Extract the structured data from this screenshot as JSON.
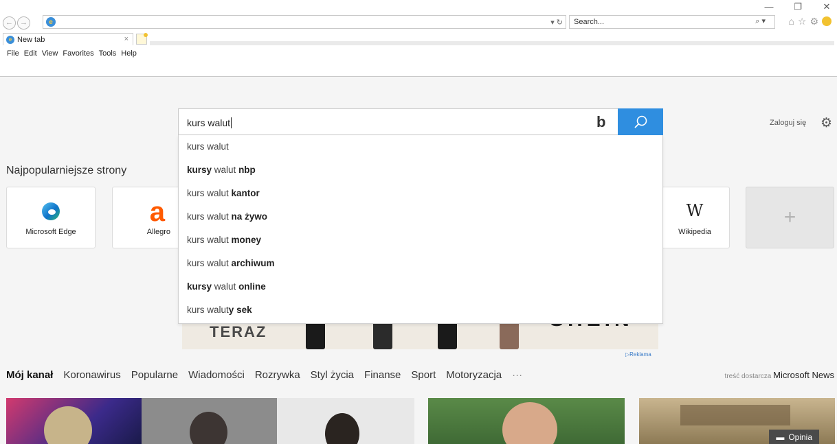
{
  "browser": {
    "tab_title": "New tab",
    "search_placeholder": "Search...",
    "menu": [
      "File",
      "Edit",
      "View",
      "Favorites",
      "Tools",
      "Help"
    ]
  },
  "header": {
    "signin": "Zaloguj się"
  },
  "search": {
    "query": "kurs walut",
    "suggestions": [
      {
        "plain": "kurs walut",
        "bold": ""
      },
      {
        "bold_prefix": "kursy",
        "plain": " walut ",
        "bold": "nbp"
      },
      {
        "plain": "kurs walut ",
        "bold": "kantor"
      },
      {
        "plain": "kurs walut ",
        "bold": "na żywo"
      },
      {
        "plain": "kurs walut ",
        "bold": "money"
      },
      {
        "plain": "kurs walut ",
        "bold": "archiwum"
      },
      {
        "bold_prefix": "kursy",
        "plain": " walut ",
        "bold": "online"
      },
      {
        "plain": "kurs waluty ",
        "bold": "sek",
        "plain_mid": "kurs walut",
        "bold_mid": "y"
      }
    ]
  },
  "popular": {
    "title": "Najpopularniejsze strony",
    "tiles": [
      {
        "label": "Microsoft Edge",
        "icon": "edge-logo"
      },
      {
        "label": "Allegro",
        "icon": "allegro-logo"
      },
      {
        "label": "Wikipedia",
        "icon": "wikipedia-logo",
        "glyph": "W"
      }
    ],
    "add_glyph": "+"
  },
  "ad": {
    "headline": "TERAZ",
    "brand": "SHEIN",
    "label": "Reklama"
  },
  "feed": {
    "tabs": [
      "Mój kanał",
      "Koronawirus",
      "Popularne",
      "Wiadomości",
      "Rozrywka",
      "Styl życia",
      "Finanse",
      "Sport",
      "Motoryzacja",
      "···"
    ],
    "provider_prefix": "treść dostarcza",
    "provider_name": "Microsoft News",
    "feedback": "Opinia"
  }
}
